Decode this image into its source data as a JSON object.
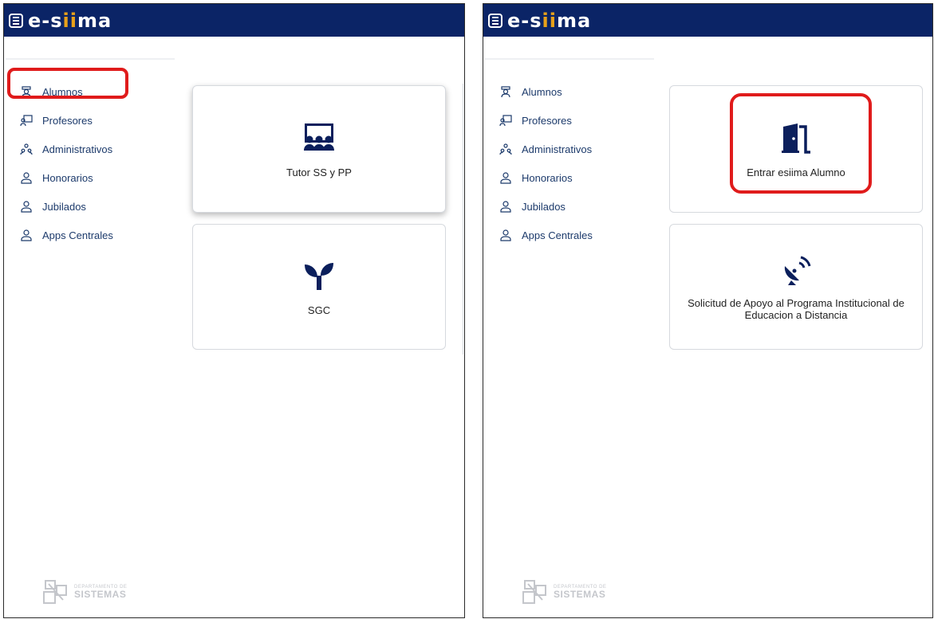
{
  "app": {
    "brand_prefix": "e-s",
    "brand_ii": "ii",
    "brand_suffix": "ma",
    "menu_icon": "hamburger-icon"
  },
  "sidebar": {
    "items": [
      {
        "label": "Alumnos",
        "icon": "student-icon"
      },
      {
        "label": "Profesores",
        "icon": "teacher-board-icon"
      },
      {
        "label": "Administrativos",
        "icon": "people-icon"
      },
      {
        "label": "Honorarios",
        "icon": "user-icon"
      },
      {
        "label": "Jubilados",
        "icon": "user-icon"
      },
      {
        "label": "Apps Centrales",
        "icon": "user-icon"
      }
    ]
  },
  "left_cards": [
    {
      "label": "Tutor SS y PP",
      "icon": "group-presentation-icon"
    },
    {
      "label": "SGC",
      "icon": "sprout-icon"
    }
  ],
  "right_cards": [
    {
      "label": "Entrar esiima Alumno",
      "icon": "door-icon"
    },
    {
      "label": "Solicitud de Apoyo al Programa Institucional de Educacion a Distancia",
      "icon": "satellite-dish-icon"
    }
  ],
  "footer": {
    "line1": "DEPARTAMENTO DE",
    "line2": "SISTEMAS"
  },
  "colors": {
    "header": "#0b2466",
    "highlight": "#e01b1b",
    "icon": "#0b1f5c"
  }
}
